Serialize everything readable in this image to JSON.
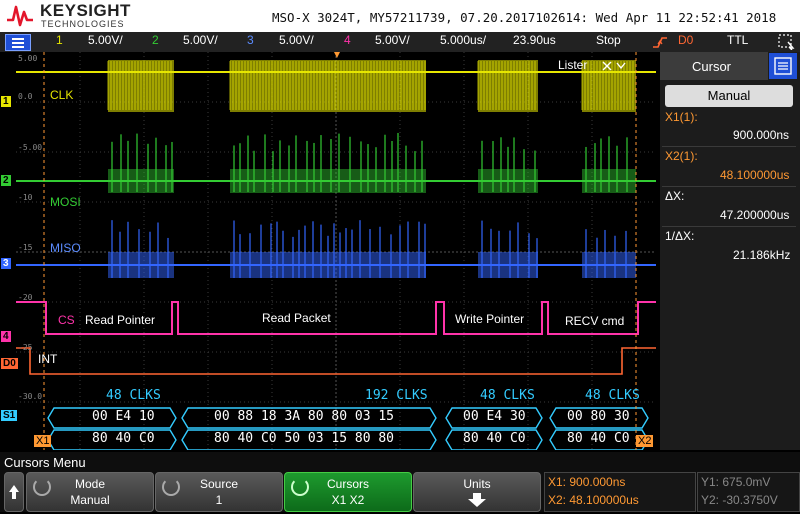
{
  "header": {
    "brand": "KEYSIGHT",
    "brand_sub": "TECHNOLOGIES",
    "title": "MSO-X 3024T, MY57211739, 07.20.2017102614: Wed Apr 11 22:52:41 2018"
  },
  "status_bar": {
    "ch1_num": "1",
    "ch1_scale": "5.00V/",
    "ch2_num": "2",
    "ch2_scale": "5.00V/",
    "ch3_num": "3",
    "ch3_scale": "5.00V/",
    "ch4_num": "4",
    "ch4_scale": "5.00V/",
    "timebase": "5.000us/",
    "delay": "23.90us",
    "run_state": "Stop",
    "trigger_source": "D0",
    "trigger_type": "TTL"
  },
  "colors": {
    "ch1": "#e6e600",
    "ch2": "#33cc33",
    "ch3": "#3366ff",
    "ch4": "#ff33aa",
    "digital": "#ff6633",
    "serial": "#33ccff",
    "cursor": "#ff9933"
  },
  "waveform": {
    "ch1_label": "CLK",
    "ch2_label": "MOSI",
    "ch3_label": "MISO",
    "ch4_label": "CS",
    "d0_label": "INT",
    "listener_label": "Lister",
    "voltage_ticks": [
      "5.00",
      "0.0",
      "-5.00",
      "-10",
      "-15",
      "-20",
      "-25",
      "-30.0"
    ],
    "cs_annotations": [
      "Read Pointer",
      "Read Packet",
      "Write Pointer",
      "RECV cmd"
    ],
    "clk_counts": [
      "48  CLKS",
      "192  CLKS",
      "48  CLKS",
      "48  CLKS"
    ],
    "mosi_bytes": [
      "00 E4 10",
      "00 88 18 3A 80 80 03 15",
      "00 E4 30",
      "00 80 30"
    ],
    "miso_bytes": [
      "80 40 C0",
      "80 40 C0 50 03 15 80 80",
      "80 40 C0",
      "80 40 C0"
    ],
    "cursor_x1": "X1",
    "cursor_x2": "X2",
    "markers": {
      "m1": "1",
      "m2": "2",
      "m3": "3",
      "m4": "4",
      "d0": "D0",
      "s1": "S1"
    }
  },
  "right_panel": {
    "title": "Cursor",
    "mode": "Manual",
    "x1_label": "X1(1):",
    "x1_value": "900.000ns",
    "x2_label": "X2(1):",
    "x2_value": "48.100000us",
    "dx_label": "ΔX:",
    "dx_value": "47.200000us",
    "inv_dx_label": "1/ΔX:",
    "inv_dx_value": "21.186kHz"
  },
  "softkeys": {
    "menu_name": "Cursors Menu",
    "mode_label": "Mode",
    "mode_value": "Manual",
    "source_label": "Source",
    "source_value": "1",
    "cursors_label": "Cursors",
    "cursors_value": "X1 X2",
    "units_label": "Units"
  },
  "readout": {
    "x1": "X1: 900.000ns",
    "x2": "X2: 48.100000us",
    "y1": "Y1: 675.0mV",
    "y2": "Y2: -30.3750V"
  }
}
